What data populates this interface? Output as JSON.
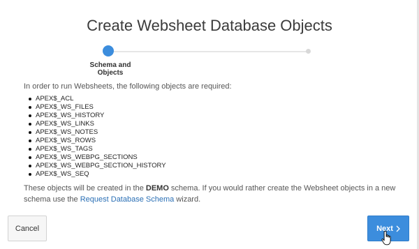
{
  "dialog": {
    "title": "Create Websheet Database Objects"
  },
  "wizard": {
    "current_step_label": "Schema and Objects"
  },
  "content": {
    "intro": "In order to run Websheets, the following objects are required:",
    "objects": [
      "APEX$_ACL",
      "APEX$_WS_FILES",
      "APEX$_WS_HISTORY",
      "APEX$_WS_LINKS",
      "APEX$_WS_NOTES",
      "APEX$_WS_ROWS",
      "APEX$_WS_TAGS",
      "APEX$_WS_WEBPG_SECTIONS",
      "APEX$_WS_WEBPG_SECTION_HISTORY",
      "APEX$_WS_SEQ"
    ],
    "note_part1": "These objects will be created in the ",
    "schema_name": "DEMO",
    "note_part2": " schema. If you would rather create the Websheet objects in a new schema use the ",
    "link_text": "Request Database Schema",
    "note_part3": " wizard."
  },
  "buttons": {
    "cancel_label": "Cancel",
    "next_label": "Next"
  },
  "colors": {
    "accent": "#3c8ddd",
    "link": "#2a6fb5"
  }
}
